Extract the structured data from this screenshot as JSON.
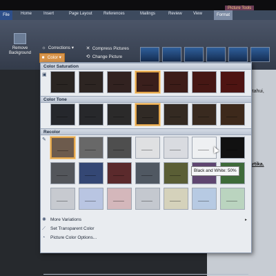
{
  "ribbon": {
    "picture_tools_label": "Picture Tools",
    "tabs": [
      "File",
      "Home",
      "Insert",
      "Page Layout",
      "References",
      "Mailings",
      "Review",
      "View",
      "Format"
    ],
    "remove_background": "Remove Background",
    "corrections": "Corrections",
    "color": "Color",
    "compress_pictures": "Compress Pictures",
    "change_picture": "Change Picture"
  },
  "document": {
    "lines": [
      "ngetahui,",
      "artika."
    ]
  },
  "gallery": {
    "sections": {
      "saturation": "Color Saturation",
      "tone": "Color Tone",
      "recolor": "Recolor"
    },
    "saturation_colors": [
      "#2a2522",
      "#2d2522",
      "#322220",
      "#3a1f1c",
      "#3d1c18",
      "#461714",
      "#4e1412"
    ],
    "tone_colors": [
      "#25272c",
      "#27282b",
      "#2b2a2a",
      "#302a25",
      "#342a22",
      "#392a1f",
      "#3d291b"
    ],
    "recolor_rows": [
      [
        "#6d5b4d",
        "#686868",
        "#4e4e4e",
        "#dfe0e2",
        "#d9dbe0",
        "#eef0f2",
        "#111111"
      ],
      [
        "#53565b",
        "#344774",
        "#5b2a2c",
        "#505862",
        "#5a5e35",
        "#5e4570",
        "#3e6a39"
      ],
      [
        "#c7cad0",
        "#b9c5e2",
        "#d4b7bb",
        "#c4c8cf",
        "#d5d2bb",
        "#b7cae3",
        "#bad4bf"
      ]
    ],
    "tooltip": "Black and White: 50%",
    "menu": {
      "more_variations": "More Variations",
      "set_transparent": "Set Transparent Color",
      "options": "Picture Color Options..."
    }
  }
}
